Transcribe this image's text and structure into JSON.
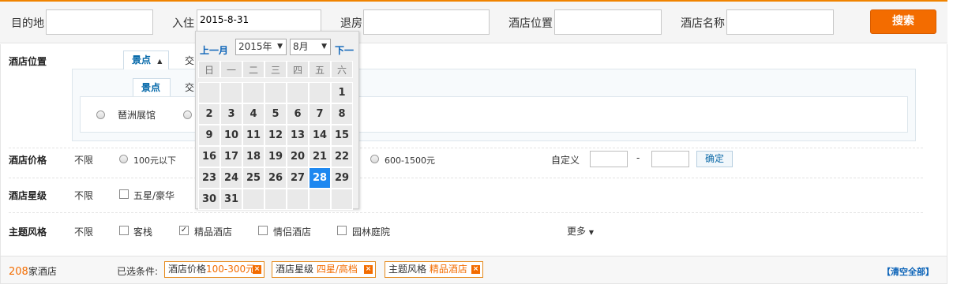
{
  "search": {
    "destination_label": "目的地",
    "destination_value": "",
    "checkin_label": "入住",
    "checkin_value": "2015-8-31",
    "checkout_label": "退房",
    "checkout_value": "",
    "location_label": "酒店位置",
    "location_value": "",
    "name_label": "酒店名称",
    "name_value": "",
    "search_button": "搜索"
  },
  "calendar": {
    "prev": "上一月",
    "next": "下一",
    "year": "2015年",
    "month": "8月",
    "weekdays": [
      "日",
      "一",
      "二",
      "三",
      "四",
      "五",
      "六"
    ],
    "leading_blanks": 6,
    "days_in_month": 31,
    "highlight_day": 28
  },
  "filters": {
    "location": {
      "label": "酒店位置",
      "tab_active": "景点",
      "tab_other": "交",
      "subtab_active": "景点",
      "subtab_other": "交",
      "options": [
        "琶洲展馆"
      ]
    },
    "price": {
      "label": "酒店价格",
      "unlimited": "不限",
      "options": [
        "100元以下",
        "600-1500元"
      ],
      "custom_label": "自定义",
      "dash": "-",
      "confirm": "确定"
    },
    "star": {
      "label": "酒店星级",
      "unlimited": "不限",
      "options": [
        "五星/豪华"
      ]
    },
    "theme": {
      "label": "主题风格",
      "unlimited": "不限",
      "options": [
        {
          "label": "客栈",
          "checked": false
        },
        {
          "label": "精品酒店",
          "checked": true
        },
        {
          "label": "情侣酒店",
          "checked": false
        },
        {
          "label": "园林庭院",
          "checked": false
        }
      ],
      "more": "更多"
    }
  },
  "summary": {
    "count": "208",
    "count_suffix": "家酒店",
    "selected_label": "已选条件:",
    "tags": [
      {
        "key": "酒店价格",
        "value": "100-300元"
      },
      {
        "key": "酒店星级",
        "value": "四星/高档"
      },
      {
        "key": "主题风格",
        "value": "精品酒店"
      }
    ],
    "clear_all": "【清空全部】"
  },
  "colors": {
    "accent": "#f36c00",
    "link": "#0b63b8",
    "today": "#1e88f0"
  }
}
